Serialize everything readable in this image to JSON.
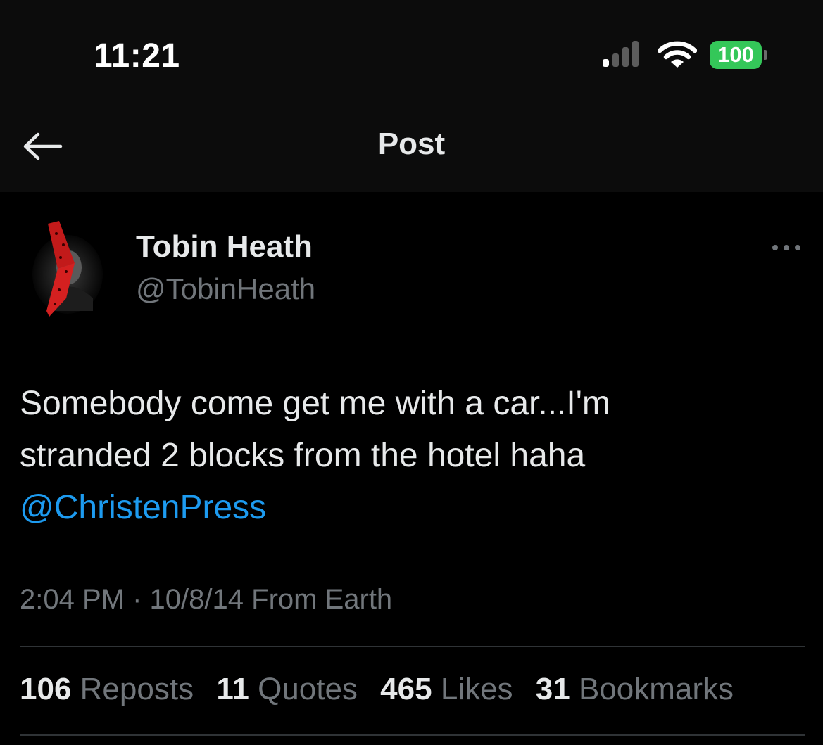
{
  "status_bar": {
    "time": "11:21",
    "signal_icon": "cellular-signal-icon",
    "wifi_icon": "wifi-icon",
    "battery_level": "100",
    "battery_color": "#34c759"
  },
  "nav": {
    "back_icon": "back-arrow-icon",
    "title": "Post"
  },
  "author": {
    "display_name": "Tobin Heath",
    "handle": "@TobinHeath"
  },
  "post": {
    "text_line_1": "Somebody come get me with a car...I'm",
    "text_line_2": "stranded 2 blocks from the hotel haha",
    "mention": "@ChristenPress",
    "time": "2:04 PM",
    "separator": "·",
    "date": "10/8/14",
    "source": "From Earth"
  },
  "stats": [
    {
      "count": "106",
      "label": "Reposts"
    },
    {
      "count": "11",
      "label": "Quotes"
    },
    {
      "count": "465",
      "label": "Likes"
    },
    {
      "count": "31",
      "label": "Bookmarks"
    }
  ],
  "colors": {
    "background": "#000000",
    "header_background": "#0c0c0c",
    "primary_text": "#e7e9ea",
    "secondary_text": "#71767b",
    "link": "#1d9bf0",
    "divider": "#2f3336"
  }
}
